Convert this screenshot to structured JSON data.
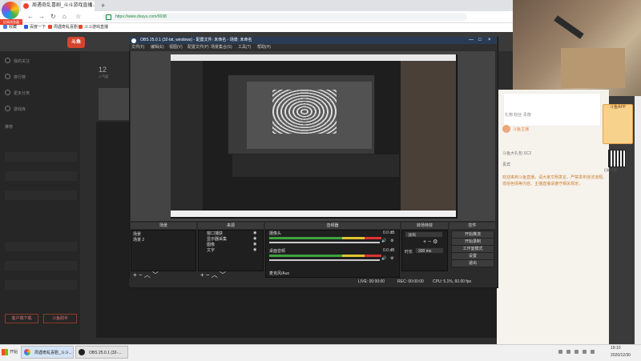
{
  "browser": {
    "logo_label": "红网浏览器",
    "tab_title": "周遇奇乱喜剧_斗斗游戏直播...",
    "tab_close": "×",
    "new_tab": "+",
    "back": "←",
    "forward": "→",
    "reload": "↻",
    "home": "⌂",
    "bookmark_star": "☆",
    "url": "https://www.douyu.com/9038",
    "bookmarks": [
      "收藏",
      "百度一下",
      "周遇奇乱喜剧",
      "斗斗游戏直播"
    ]
  },
  "douyu": {
    "logo": "斗鱼",
    "sidebar": [
      "我的关注",
      "排行榜",
      "更多分类",
      "游戏库"
    ],
    "sidebar_heading": "推荐",
    "viewer_count": "12",
    "viewer_label": "人气值",
    "buttons": [
      "客户端下载",
      "斗鱼助手"
    ]
  },
  "right_panel": {
    "tabs": [
      "礼物",
      "粉丝",
      "贵族"
    ],
    "streamer": "斗鱼主播",
    "gifts": [
      "斗鱼大礼包 SC2",
      "贵宾"
    ],
    "notice": "欢迎来到斗鱼直播，请大家文明发言，严禁发布违法违规、低俗色情等内容。主播直播请遵守相关规定。",
    "promo": "斗鱼APP",
    "qr_label": "扫码下载"
  },
  "obs": {
    "title": "OBS 25.0.1 (32-bit, windows) - 配置文件: 未命名 - 场景: 未命名",
    "menus": [
      "文件(F)",
      "编辑(E)",
      "视图(V)",
      "配置文件(P)",
      "场景集合(S)",
      "工具(T)",
      "帮助(H)"
    ],
    "minimize": "—",
    "maximize": "□",
    "close": "×",
    "panels": {
      "scenes": "场景",
      "sources": "来源",
      "mixer": "音频器",
      "transitions": "转场特效",
      "controls": "控件"
    },
    "scene_items": [
      "场景",
      "场景 2"
    ],
    "source_items": [
      "窗口捕获",
      "显示器采集",
      "图像",
      "文字"
    ],
    "mixer_tracks": [
      {
        "name": "摄像头",
        "db": "0.0 dB"
      },
      {
        "name": "桌面音频",
        "db": "0.0 dB"
      },
      {
        "name": "麦克风/Aux",
        "db": ""
      }
    ],
    "transition_select": "淡出",
    "duration_label": "时长",
    "duration_value": "300 ms",
    "controls": [
      "开始推流",
      "开始录制",
      "工作室模式",
      "设置",
      "退出"
    ],
    "status": {
      "live": "LIVE: 00:00:00",
      "rec": "REC: 00:00:00",
      "cpu": "CPU: 5.1%, 60.00 fps"
    }
  },
  "taskbar": {
    "start": "开始",
    "items": [
      "周遇奇乱喜剧_斗斗...",
      "OBS 25.0.1 (32-..."
    ],
    "time": "19:10",
    "date": "2020/12/30"
  }
}
